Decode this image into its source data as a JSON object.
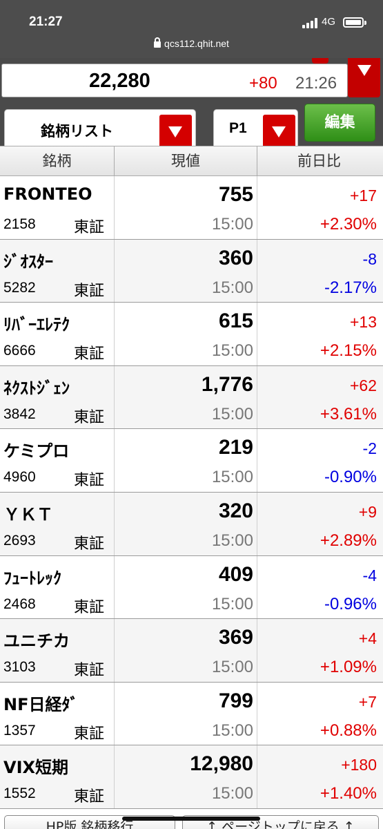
{
  "status": {
    "time": "21:27",
    "network": "4G",
    "url": "qcs112.qhit.net"
  },
  "index": {
    "value": "22,280",
    "change": "+80",
    "time": "21:26"
  },
  "controls": {
    "list_label": "銘柄リスト",
    "page_label": "P1",
    "edit_label": "編集"
  },
  "table": {
    "headers": [
      "銘柄",
      "現値",
      "前日比"
    ],
    "rows": [
      {
        "name": "FRONTEO",
        "code": "2158",
        "market": "東証",
        "price": "755",
        "time": "15:00",
        "change": "+17",
        "percent": "+2.30%",
        "dir": "up"
      },
      {
        "name": "ｼﾞｵｽﾀｰ",
        "code": "5282",
        "market": "東証",
        "price": "360",
        "time": "15:00",
        "change": "-8",
        "percent": "-2.17%",
        "dir": "down"
      },
      {
        "name": "ﾘﾊﾞｰｴﾚﾃｸ",
        "code": "6666",
        "market": "東証",
        "price": "615",
        "time": "15:00",
        "change": "+13",
        "percent": "+2.15%",
        "dir": "up"
      },
      {
        "name": "ﾈｸｽﾄｼﾞｪﾝ",
        "code": "3842",
        "market": "東証",
        "price": "1,776",
        "time": "15:00",
        "change": "+62",
        "percent": "+3.61%",
        "dir": "up"
      },
      {
        "name": "ケミプロ",
        "code": "4960",
        "market": "東証",
        "price": "219",
        "time": "15:00",
        "change": "-2",
        "percent": "-0.90%",
        "dir": "down"
      },
      {
        "name": "ＹＫＴ",
        "code": "2693",
        "market": "東証",
        "price": "320",
        "time": "15:00",
        "change": "+9",
        "percent": "+2.89%",
        "dir": "up"
      },
      {
        "name": "ﾌｭｰﾄﾚｯｸ",
        "code": "2468",
        "market": "東証",
        "price": "409",
        "time": "15:00",
        "change": "-4",
        "percent": "-0.96%",
        "dir": "down"
      },
      {
        "name": "ユニチカ",
        "code": "3103",
        "market": "東証",
        "price": "369",
        "time": "15:00",
        "change": "+4",
        "percent": "+1.09%",
        "dir": "up"
      },
      {
        "name": "NF日経ﾀﾞ",
        "code": "1357",
        "market": "東証",
        "price": "799",
        "time": "15:00",
        "change": "+7",
        "percent": "+0.88%",
        "dir": "up"
      },
      {
        "name": "VIX短期",
        "code": "1552",
        "market": "東証",
        "price": "12,980",
        "time": "15:00",
        "change": "+180",
        "percent": "+1.40%",
        "dir": "up"
      }
    ]
  },
  "bottom": {
    "left_label": "HP版 銘柄移行",
    "right_label": "↑ ページトップに戻る ↑"
  },
  "colors": {
    "up": "#e00000",
    "down": "#0000e0",
    "accent_red": "#d40000",
    "edit_green": "#3f9f22"
  }
}
